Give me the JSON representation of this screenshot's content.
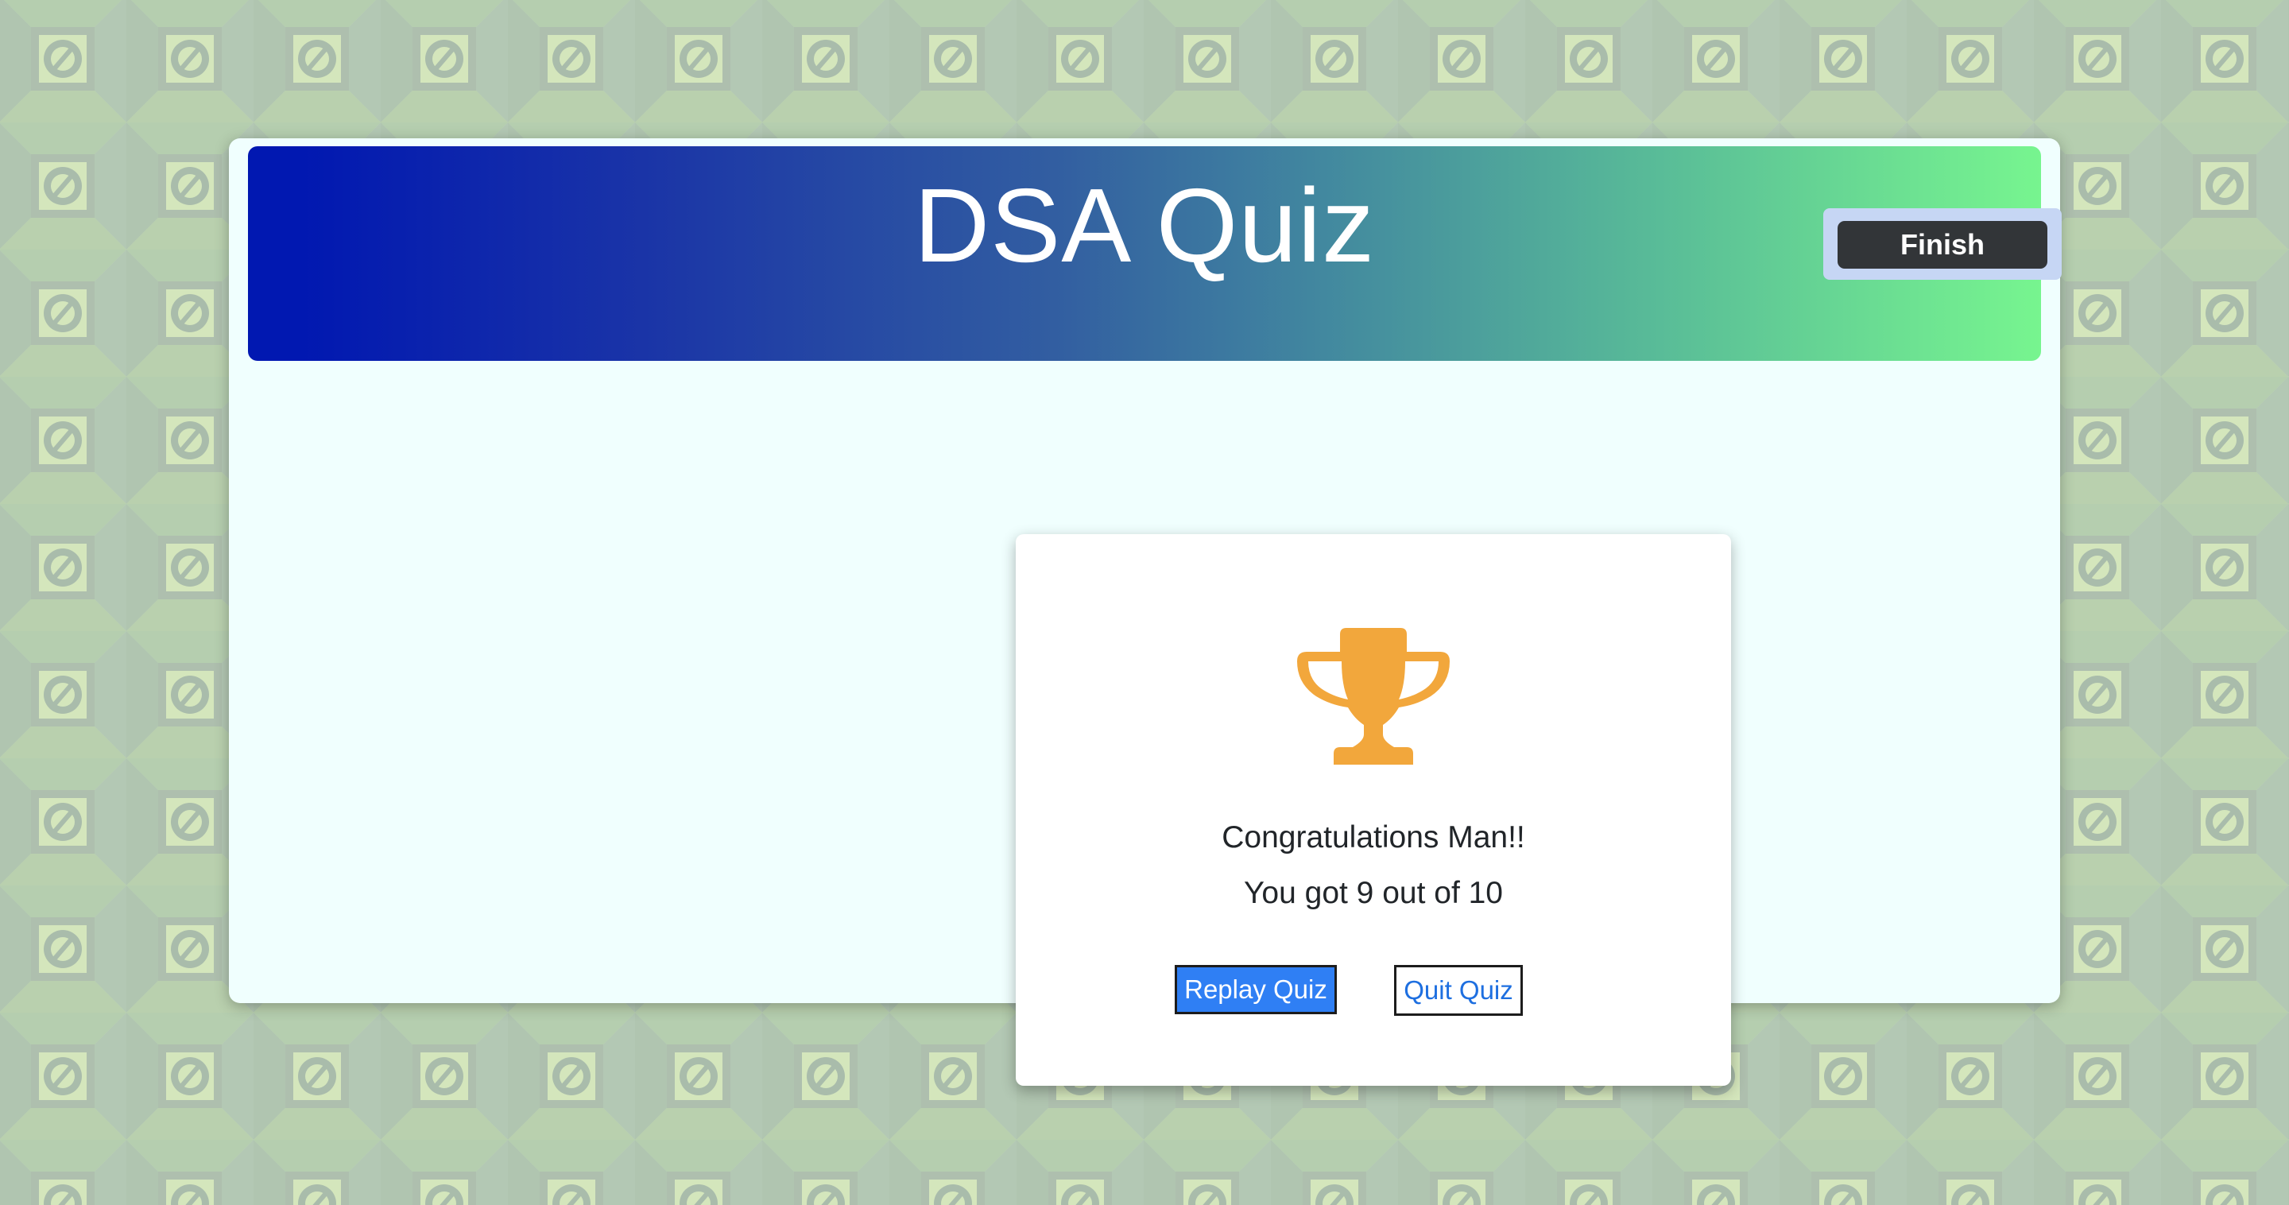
{
  "app": {
    "title": "DSA Quiz",
    "finish_label": "Finish"
  },
  "result": {
    "congrats": "Congratulations Man!!",
    "score_text": "You got 9 out of 10",
    "score": 9,
    "total": 10,
    "replay_label": "Replay Quiz",
    "quit_label": "Quit Quiz"
  },
  "icons": {
    "trophy": "trophy-icon",
    "background_tile": "disc-tile-icon"
  },
  "colors": {
    "header_gradient_start": "#0118b1",
    "header_gradient_end": "#77f58f",
    "trophy": "#f2a73c",
    "replay_button": "#2f7ff4",
    "finish_button": "#323538",
    "card_background": "#f0fffe",
    "page_background": "#c5d9bb"
  }
}
